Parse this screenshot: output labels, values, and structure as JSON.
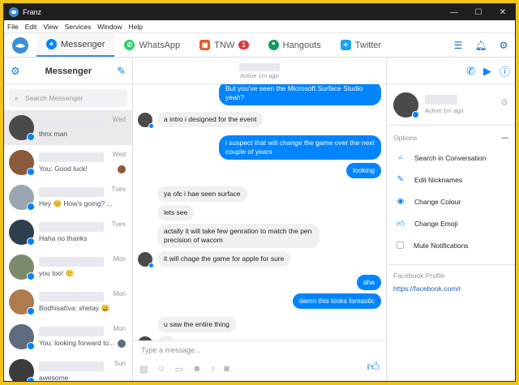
{
  "window": {
    "title": "Franz",
    "controls": [
      "—",
      "☐",
      "✕"
    ]
  },
  "menubar": [
    "File",
    "Edit",
    "View",
    "Services",
    "Window",
    "Help"
  ],
  "tabs": [
    {
      "label": "Messenger",
      "icon": "messenger-icon",
      "color": "#0084ff",
      "active": true
    },
    {
      "label": "WhatsApp",
      "icon": "whatsapp-icon",
      "color": "#25d366"
    },
    {
      "label": "TNW",
      "icon": "tnw-icon",
      "color": "#e55b2b",
      "badge": "1"
    },
    {
      "label": "Hangouts",
      "icon": "hangouts-icon",
      "color": "#0f9d58"
    },
    {
      "label": "Twitter",
      "icon": "twitter-icon",
      "color": "#1da1f2"
    }
  ],
  "left": {
    "title": "Messenger",
    "search_placeholder": "Search Messenger",
    "conversations": [
      {
        "snippet": "thnx man",
        "time": "Wed",
        "avatar": "#4a4a4a"
      },
      {
        "snippet": "You: Good luck!",
        "time": "Wed",
        "avatar": "#8a5a3c"
      },
      {
        "snippet": "Hey 😊 How's going? ...",
        "time": "Tues",
        "avatar": "#9aa7b2"
      },
      {
        "snippet": "Haha no thanks",
        "time": "Tues",
        "avatar": "#2c3e50"
      },
      {
        "snippet": "you too! 🙂",
        "time": "Mon",
        "avatar": "#7b8c6a"
      },
      {
        "snippet": "Bodhisattva: shetay 😀",
        "time": "Mon",
        "avatar": "#b07a4f"
      },
      {
        "snippet": "You: looking forward to...",
        "time": "Mon",
        "avatar": "#5d6d7e"
      },
      {
        "snippet": "awesome",
        "time": "Sun",
        "avatar": "#3b3b3b"
      }
    ]
  },
  "chat": {
    "status": "Active 1m ago",
    "messages": [
      {
        "side": "me",
        "text": "But you've seen the Microsoft Surface Studio yeah?"
      },
      {
        "side": "them",
        "text": "a intro i designed for the event",
        "avatar": true
      },
      {
        "side": "me",
        "text": "i suspect that will change the game over the next couple of years"
      },
      {
        "side": "me",
        "text": "looking"
      },
      {
        "side": "them",
        "text": "ya ofc i hae seen surface"
      },
      {
        "side": "them",
        "text": "lets see"
      },
      {
        "side": "them",
        "text": "actally it will take few genration to match the pen precision of wacom"
      },
      {
        "side": "them",
        "text": "it will chage the game for apple for sure",
        "avatar": true
      },
      {
        "side": "me",
        "text": "aha"
      },
      {
        "side": "me",
        "text": "damn this looks fantastic"
      },
      {
        "side": "them",
        "text": "u saw the entire thing"
      },
      {
        "side": "them",
        "text": "?",
        "avatar": true
      }
    ],
    "composer_placeholder": "Type a message..."
  },
  "right": {
    "status": "Active 1m ago",
    "options_label": "Options",
    "options": [
      {
        "label": "Search in Conversation",
        "icon": "search-icon"
      },
      {
        "label": "Edit Nicknames",
        "icon": "pencil-icon"
      },
      {
        "label": "Change Colour",
        "icon": "palette-icon"
      },
      {
        "label": "Change Emoji",
        "icon": "thumbs-up-icon"
      },
      {
        "label": "Mute Notifications",
        "icon": "checkbox-icon"
      }
    ],
    "fb_profile_label": "Facebook Profile",
    "fb_profile_link": "https://facebook.com/r"
  }
}
